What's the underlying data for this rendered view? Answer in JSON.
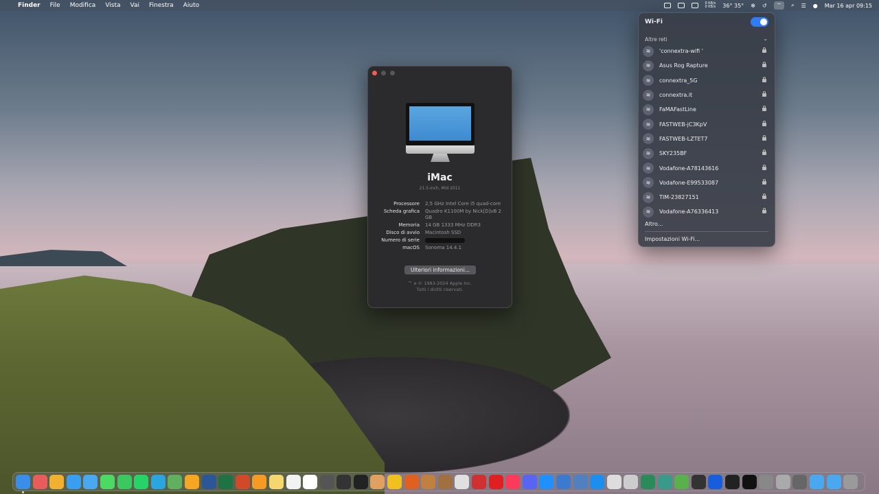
{
  "menubar": {
    "apple_glyph": "",
    "app_name": "Finder",
    "menus": [
      "File",
      "Modifica",
      "Vista",
      "Vai",
      "Finestra",
      "Aiuto"
    ],
    "net_up": "0 KB/s",
    "net_down": "0 KB/s",
    "temps": "36° 35°",
    "datetime": "Mar 16 apr  09:15"
  },
  "about": {
    "model": "iMac",
    "submodel": "21.5-inch, Mid 2011",
    "specs": [
      {
        "label": "Processore",
        "value": "2,5 GHz Intel Core i5 quad-core"
      },
      {
        "label": "Scheda grafica",
        "value": "Quadro K1100M by Nick[D]vB 2 GB"
      },
      {
        "label": "Memoria",
        "value": "14 GB 1333 MHz DDR3"
      },
      {
        "label": "Disco di avvio",
        "value": "Macintosh SSD"
      },
      {
        "label": "Numero di serie",
        "value": ""
      },
      {
        "label": "macOS",
        "value": "Sonoma 14.4.1"
      }
    ],
    "more_button": "Ulteriori informazioni...",
    "legal_line1": "™ e © 1983-2024 Apple Inc.",
    "legal_line2": "Tutti i diritti riservati."
  },
  "wifi": {
    "title": "Wi-Fi",
    "enabled": true,
    "section": "Altre reti",
    "networks": [
      "'connextra-wifi '",
      "Asus Rog Rapture",
      "connextra_5G",
      "connextra.it",
      "FaMAFastLine",
      "FASTWEB-jC3KpV",
      "FASTWEB-LZTET7",
      "SKY235BF",
      "Vodafone-A78143616",
      "Vodafone-E99533087",
      "TIM-23827151",
      "Vodafone-A76336413"
    ],
    "other": "Altro...",
    "settings": "Impostazioni Wi-Fi..."
  },
  "dock": {
    "apps": [
      {
        "name": "finder-icon",
        "color": "#3a8ee8"
      },
      {
        "name": "launchpad-icon",
        "color": "#e85c5c"
      },
      {
        "name": "chrome-icon",
        "color": "#f0b030"
      },
      {
        "name": "safari-icon",
        "color": "#3a9ef0"
      },
      {
        "name": "mail-icon",
        "color": "#4aa8f0"
      },
      {
        "name": "messages-icon",
        "color": "#4cd964"
      },
      {
        "name": "facetime-icon",
        "color": "#3cc860"
      },
      {
        "name": "whatsapp-icon",
        "color": "#25d366"
      },
      {
        "name": "telegram-icon",
        "color": "#2aa5e0"
      },
      {
        "name": "maps-icon",
        "color": "#60b060"
      },
      {
        "name": "photos-icon",
        "color": "#f5a623"
      },
      {
        "name": "word-icon",
        "color": "#2b5797"
      },
      {
        "name": "excel-icon",
        "color": "#1f7244"
      },
      {
        "name": "powerpoint-icon",
        "color": "#d04a2a"
      },
      {
        "name": "pages-icon",
        "color": "#f59a23"
      },
      {
        "name": "notes-icon",
        "color": "#f5d76e"
      },
      {
        "name": "reminders-icon",
        "color": "#f2f2f2"
      },
      {
        "name": "calendar-icon",
        "color": "#ffffff"
      },
      {
        "name": "calculator-icon",
        "color": "#555555"
      },
      {
        "name": "davinci-icon",
        "color": "#333333"
      },
      {
        "name": "finalcut-icon",
        "color": "#222222"
      },
      {
        "name": "app-icon",
        "color": "#e0a060"
      },
      {
        "name": "app-icon",
        "color": "#f0c020"
      },
      {
        "name": "app-icon",
        "color": "#e06020"
      },
      {
        "name": "app-icon",
        "color": "#c08040"
      },
      {
        "name": "app-icon",
        "color": "#a07040"
      },
      {
        "name": "app-icon",
        "color": "#e0e0e0"
      },
      {
        "name": "app-icon",
        "color": "#d03030"
      },
      {
        "name": "app-icon",
        "color": "#e02020"
      },
      {
        "name": "music-icon",
        "color": "#fa3c5a"
      },
      {
        "name": "discord-icon",
        "color": "#5865f2"
      },
      {
        "name": "appstore-icon",
        "color": "#1e90ff"
      },
      {
        "name": "qbittorrent-icon",
        "color": "#3c7ad0"
      },
      {
        "name": "app-icon",
        "color": "#5080c0"
      },
      {
        "name": "xcode-icon",
        "color": "#1c8ef0"
      },
      {
        "name": "app-icon",
        "color": "#dddddd"
      },
      {
        "name": "app-icon",
        "color": "#cccccc"
      },
      {
        "name": "timemachine-icon",
        "color": "#2a8a5a"
      },
      {
        "name": "app-icon",
        "color": "#3a9a8a"
      },
      {
        "name": "app-icon",
        "color": "#5ab04a"
      },
      {
        "name": "app-icon",
        "color": "#333333"
      },
      {
        "name": "bitwarden-icon",
        "color": "#175ddc"
      },
      {
        "name": "activity-monitor-icon",
        "color": "#222222"
      },
      {
        "name": "terminal-icon",
        "color": "#111111"
      },
      {
        "name": "system-settings-icon",
        "color": "#888888"
      },
      {
        "name": "app-icon",
        "color": "#aaaaaa"
      },
      {
        "name": "help-icon",
        "color": "#666666"
      },
      {
        "name": "folder-icon",
        "color": "#4aa8f0"
      },
      {
        "name": "folder-icon",
        "color": "#4aa8f0"
      },
      {
        "name": "trash-icon",
        "color": "#9a9a9a"
      }
    ]
  }
}
